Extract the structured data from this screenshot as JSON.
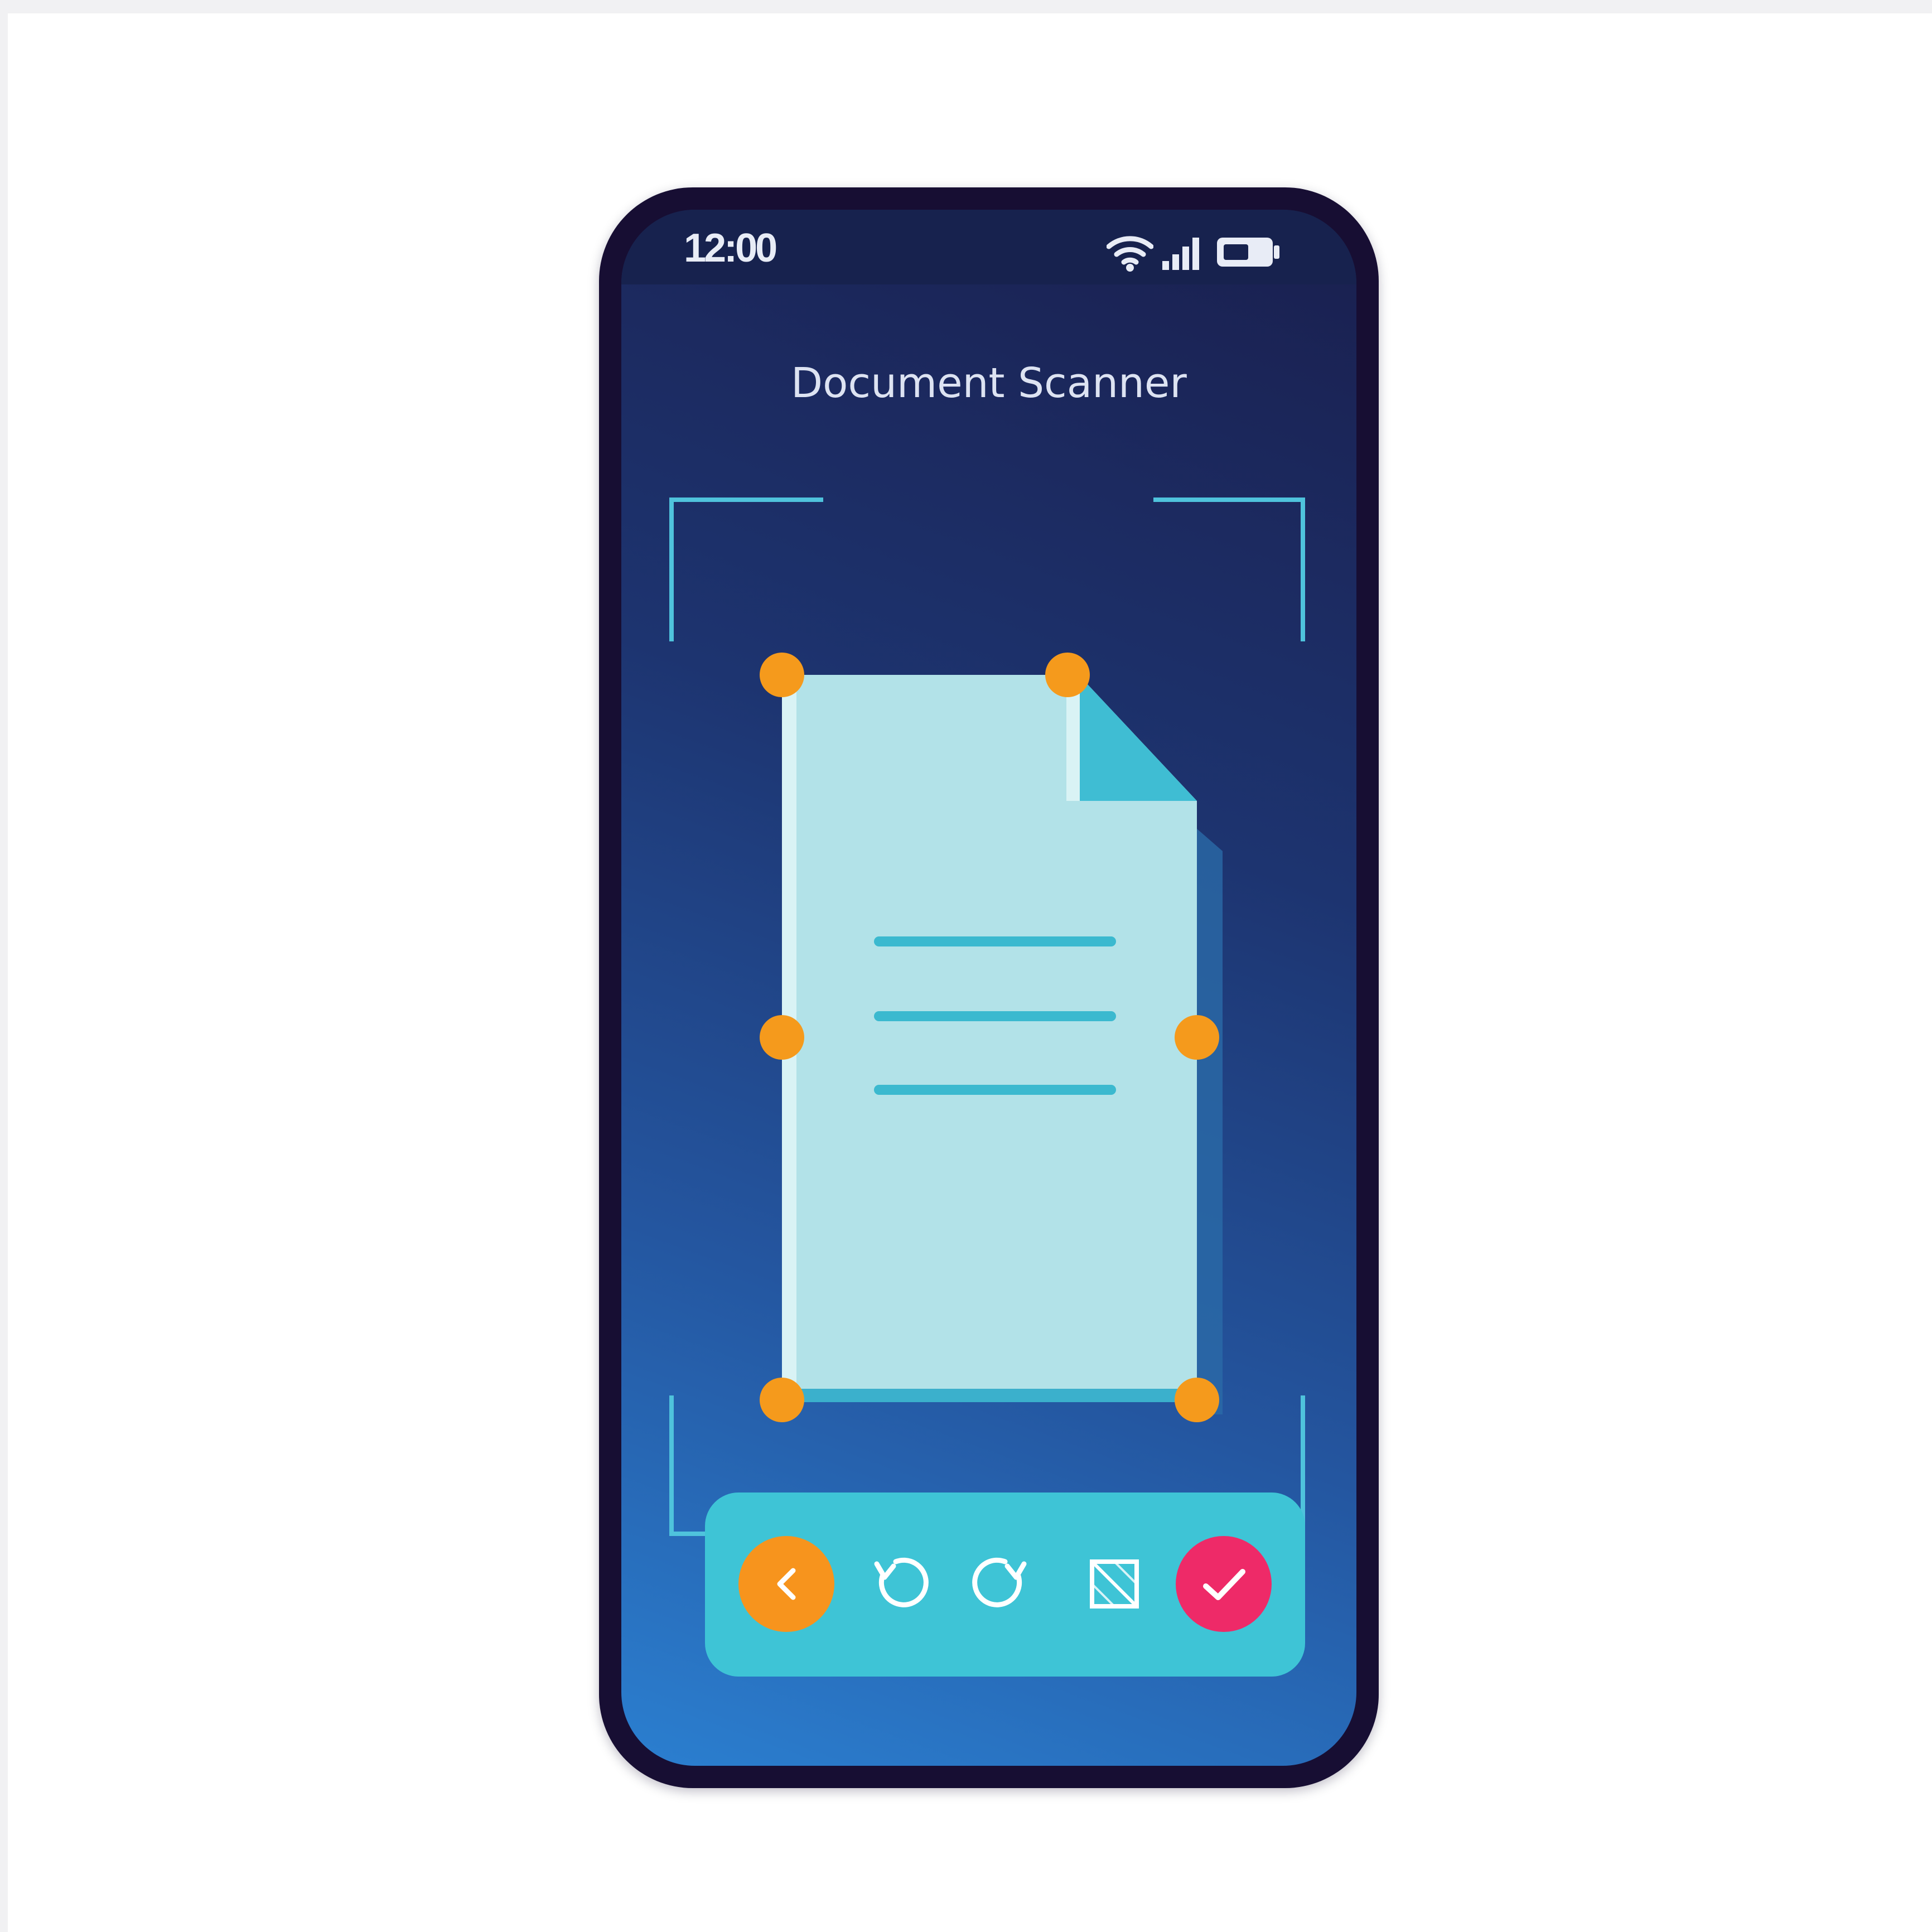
{
  "status_bar": {
    "time": "12:00",
    "icons": [
      "wifi-icon",
      "cellular-signal-icon",
      "battery-icon"
    ]
  },
  "app": {
    "title": "Document Scanner"
  },
  "document": {
    "icon": "document-icon",
    "text_line_count": 3,
    "crop_handles": [
      "top-left",
      "top-right",
      "middle-left",
      "middle-right",
      "bottom-left",
      "bottom-right"
    ]
  },
  "toolbar": {
    "buttons": [
      {
        "name": "back-button",
        "icon": "chevron-left-icon"
      },
      {
        "name": "rotate-left-button",
        "icon": "rotate-left-icon"
      },
      {
        "name": "rotate-right-button",
        "icon": "rotate-right-icon"
      },
      {
        "name": "crop-button",
        "icon": "crop-icon"
      },
      {
        "name": "confirm-button",
        "icon": "check-icon"
      }
    ]
  },
  "colors": {
    "phone_frame": "#170e33",
    "screen_top": "#1a1f4e",
    "screen_bottom": "#2b7fd0",
    "viewfinder": "#4fc3dc",
    "document_paper": "#b2e2e8",
    "document_fold": "#3fbdd3",
    "document_lines": "#3bb9cf",
    "crop_handle": "#f59a1c",
    "toolbar_bg": "#3ec4d6",
    "back_button": "#f7941d",
    "confirm_button": "#ee2a68"
  }
}
